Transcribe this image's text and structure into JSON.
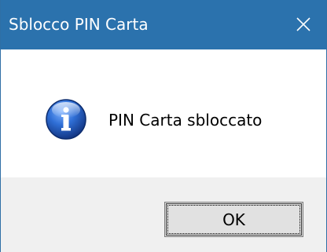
{
  "window": {
    "title": "Sblocco PIN Carta"
  },
  "icons": {
    "info": "info-icon",
    "close": "close-icon"
  },
  "message": {
    "text": "PIN Carta sbloccato"
  },
  "buttons": {
    "ok_label": "OK"
  },
  "colors": {
    "titlebar": "#2b72ad",
    "title_text": "#ffffff",
    "footer": "#f0f0f0",
    "info_icon_blue": "#1c4fa8"
  }
}
